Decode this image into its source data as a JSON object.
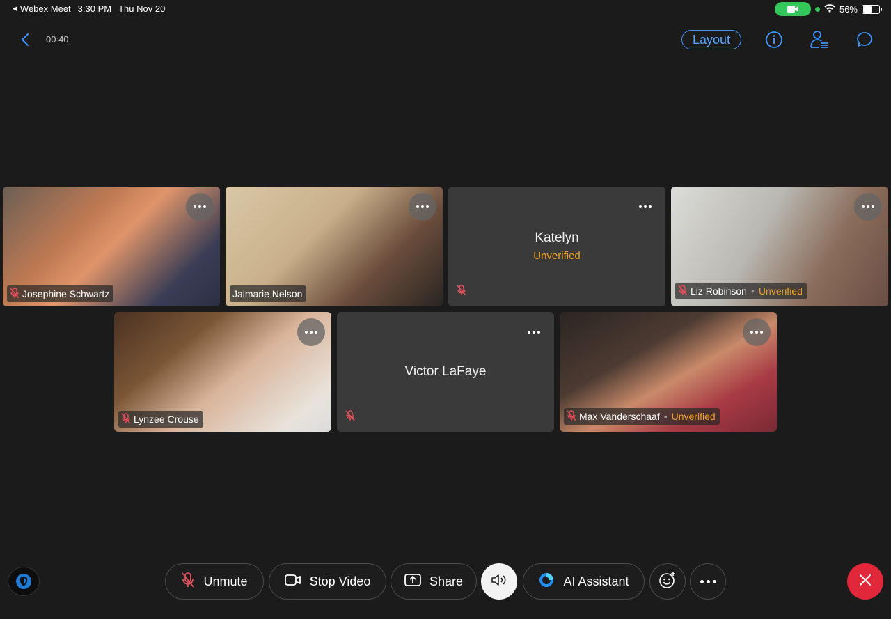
{
  "status": {
    "back_app": "Webex Meet",
    "time": "3:30 PM",
    "date": "Thu Nov 20",
    "battery": "56%",
    "battery_level": 0.56
  },
  "topbar": {
    "timer": "00:40",
    "layout_label": "Layout"
  },
  "participants": [
    {
      "name": "Josephine Schwartz",
      "unverified": "",
      "video": true,
      "muted": true
    },
    {
      "name": "Jaimarie Nelson",
      "unverified": "",
      "video": true,
      "muted": false
    },
    {
      "name": "Katelyn",
      "unverified": "Unverified",
      "video": false,
      "muted": true
    },
    {
      "name": "Liz Robinson",
      "unverified": "Unverified",
      "video": true,
      "muted": true
    },
    {
      "name": "Lynzee Crouse",
      "unverified": "",
      "video": true,
      "muted": true
    },
    {
      "name": "Victor LaFaye",
      "unverified": "",
      "video": false,
      "muted": true
    },
    {
      "name": "Max Vanderschaaf",
      "unverified": "Unverified",
      "video": true,
      "muted": true
    }
  ],
  "controls": {
    "unmute": "Unmute",
    "stop_video": "Stop Video",
    "share": "Share",
    "ai_assistant": "AI Assistant"
  },
  "colors": {
    "accent": "#3d96ff",
    "unverified": "#f0a020",
    "mute_red": "#e8505b",
    "end_call": "#e0283a",
    "status_green": "#34c759"
  }
}
